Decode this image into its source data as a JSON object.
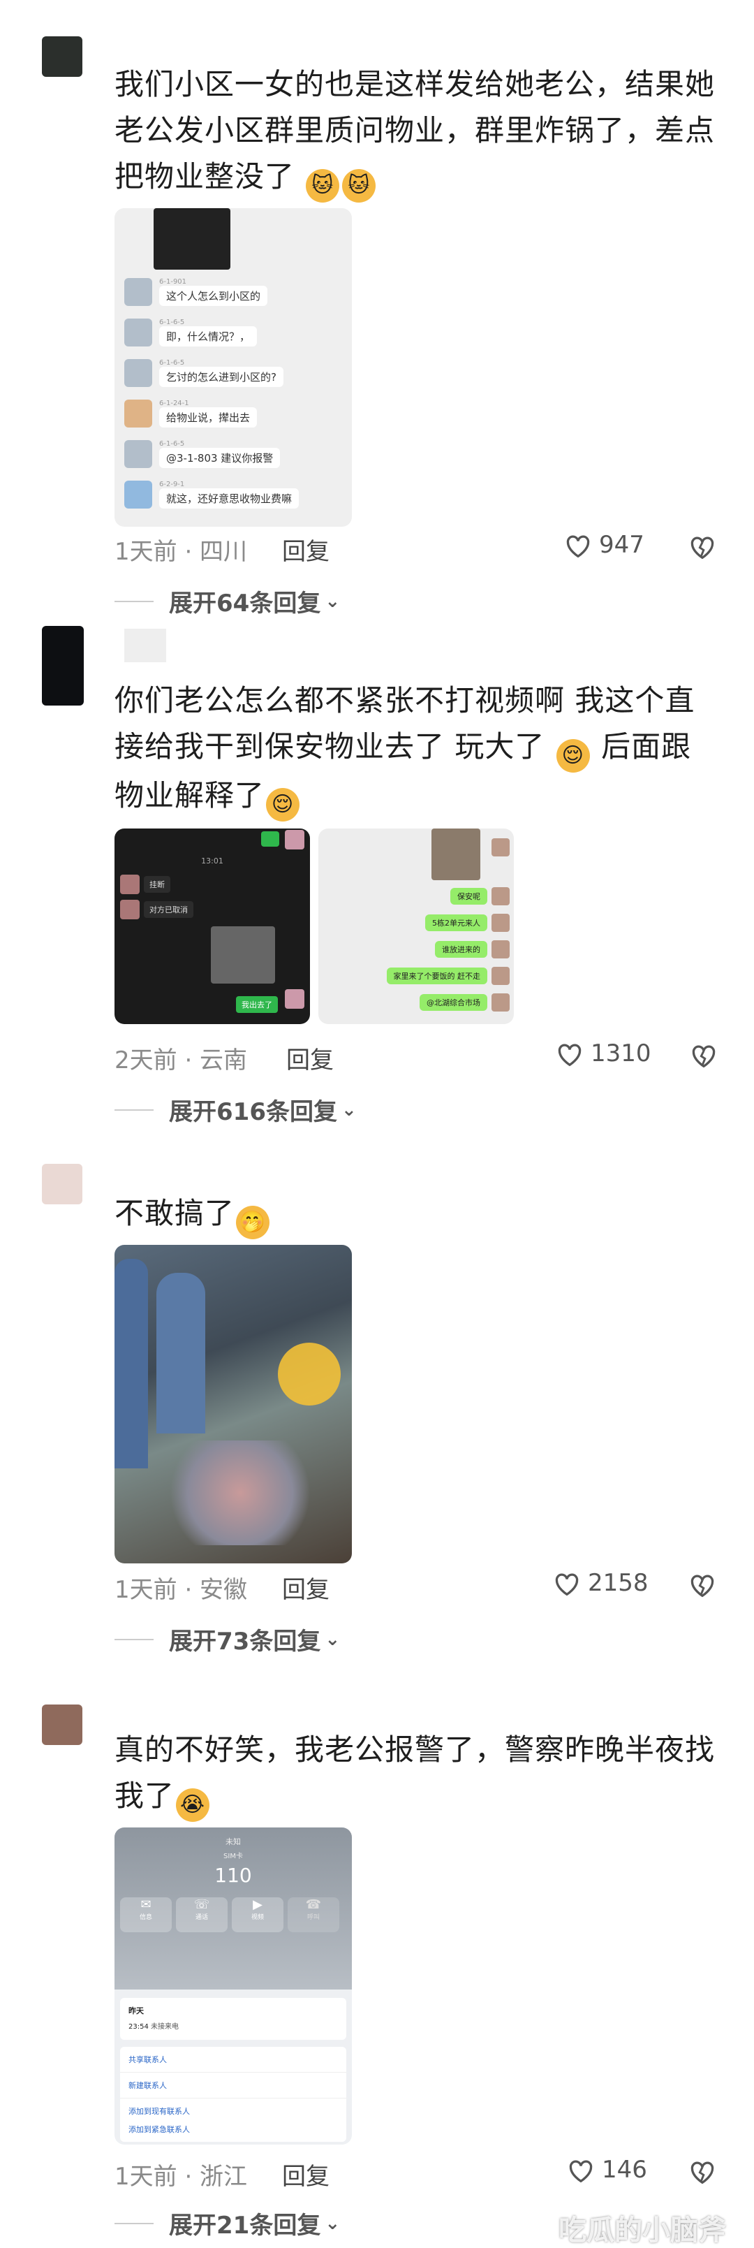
{
  "comments": [
    {
      "text": "我们小区一女的也是这样发给她老公，结果她老公发小区群里质问物业，群里炸锅了，差点把物业整没了",
      "meta": "1天前 · 四川",
      "reply_label": "回复",
      "likes": "947",
      "expand": "展开64条回复",
      "chat": [
        {
          "name": "6-1-901",
          "msg": "这个人怎么到小区的"
        },
        {
          "name": "6-1-6-5",
          "msg": "即，什么情况？，"
        },
        {
          "name": "6-1-6-5",
          "msg": "乞讨的怎么进到小区的?"
        },
        {
          "name": "6-1-24-1",
          "msg": "给物业说，撵出去"
        },
        {
          "name": "6-1-6-5",
          "msg": "@3-1-803 建议你报警"
        },
        {
          "name": "6-2-9-1",
          "msg": "就这，还好意思收物业费嘛"
        }
      ]
    },
    {
      "text": "你们老公怎么都不紧张不打视频啊 我这个直接给我干到保安物业去了 玩大了",
      "text2": "后面跟物业解释了",
      "meta": "2天前 · 云南",
      "reply_label": "回复",
      "likes": "1310",
      "expand": "展开616条回复",
      "dark_chat": {
        "time": "13:01",
        "row1": "挂断",
        "row2": "对方已取消",
        "sent": "我出去了"
      },
      "green_chat": [
        "保安呢",
        "5栋2单元来人",
        "谁放进来的",
        "家里来了个要饭的 赶不走",
        "@北湖综合市场"
      ]
    },
    {
      "text": "不敢搞了",
      "meta": "1天前 · 安徽",
      "reply_label": "回复",
      "likes": "2158",
      "expand": "展开73条回复"
    },
    {
      "text": "真的不好笑，我老公报警了，警察昨晚半夜找我了",
      "meta": "1天前 · 浙江",
      "reply_label": "回复",
      "likes": "146",
      "expand": "展开21条回复",
      "call": {
        "top_small": "未知",
        "sim": "SIM卡",
        "number": "110",
        "actions": [
          "信息",
          "通话",
          "视频",
          "呼叫"
        ],
        "day": "昨天",
        "time": "23:54",
        "status": "未接来电",
        "links": [
          "共享联系人",
          "新建联系人",
          "添加到现有联系人",
          "添加到紧急联系人"
        ]
      }
    }
  ],
  "watermark": "吃瓜的小脑斧",
  "colors": {
    "accent": "#95ec69",
    "meta": "#8a8a8a",
    "emoji": "#f5b942"
  }
}
